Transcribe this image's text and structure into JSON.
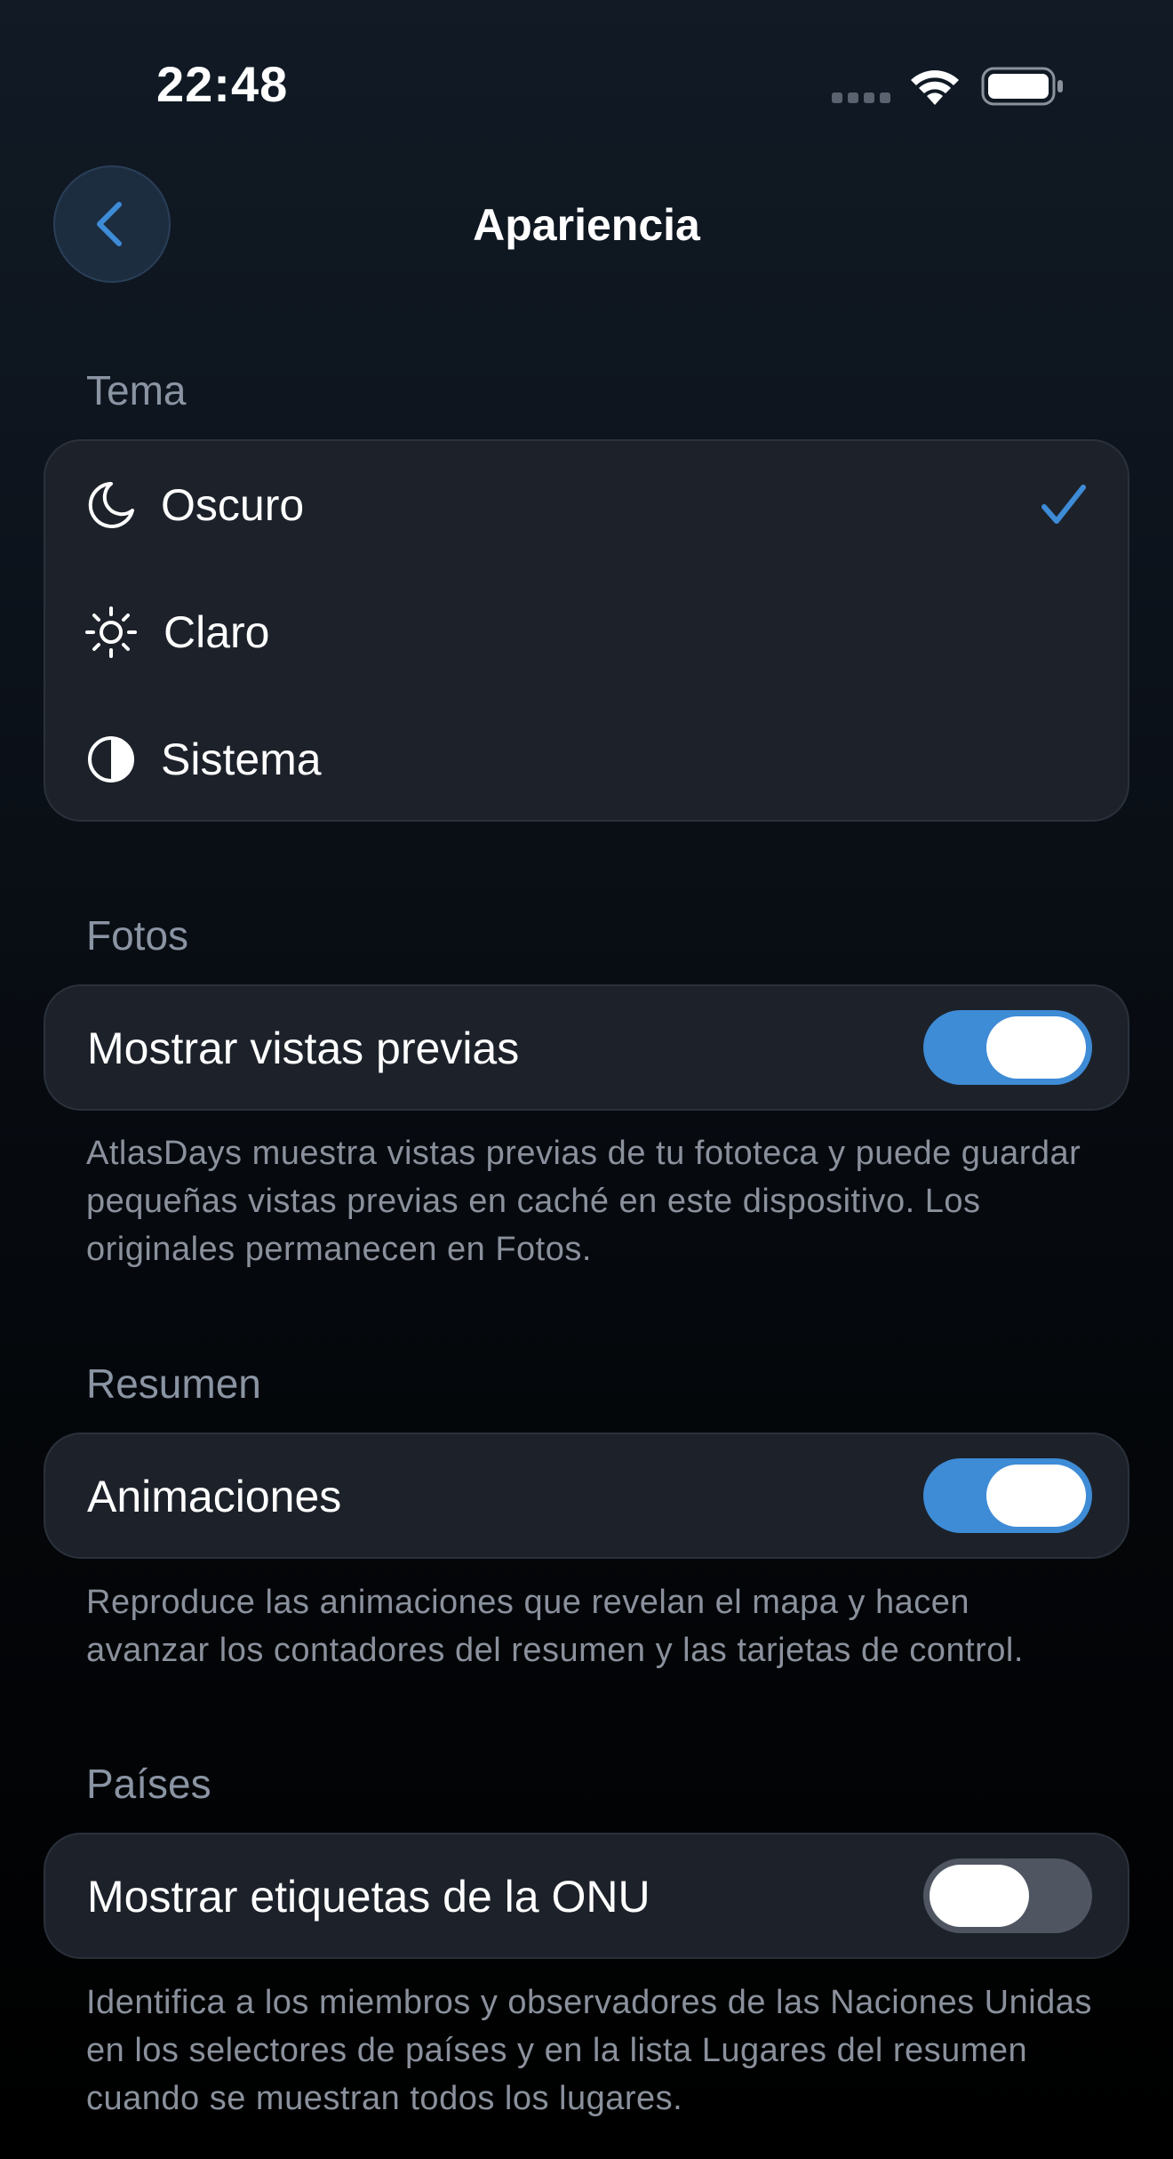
{
  "status_bar": {
    "time": "22:48"
  },
  "nav": {
    "title": "Apariencia",
    "back_icon": "chevron-left-icon"
  },
  "theme_section": {
    "header": "Tema",
    "options": [
      {
        "label": "Oscuro",
        "icon": "moon-icon",
        "selected": true
      },
      {
        "label": "Claro",
        "icon": "sun-icon",
        "selected": false
      },
      {
        "label": "Sistema",
        "icon": "half-circle-icon",
        "selected": false
      }
    ]
  },
  "photos_section": {
    "header": "Fotos",
    "toggle_label": "Mostrar vistas previas",
    "toggle_on": true,
    "footnote": "AtlasDays muestra vistas previas de tu fototeca y puede guardar pequeñas vistas previas en caché en este dispositivo. Los originales permanecen en Fotos."
  },
  "summary_section": {
    "header": "Resumen",
    "toggle_label": "Animaciones",
    "toggle_on": true,
    "footnote": "Reproduce las animaciones que revelan el mapa y hacen avanzar los contadores del resumen y las tarjetas de control."
  },
  "countries_section": {
    "header": "Países",
    "toggle_label": "Mostrar etiquetas de la ONU",
    "toggle_on": false,
    "footnote": "Identifica a los miembros y observadores de las Naciones Unidas en los selectores de países y en la lista Lugares del resumen cuando se muestran todos los lugares."
  },
  "colors": {
    "accent": "#3e8bd6",
    "card_bg": "#1d222a",
    "toggle_off": "#4f5561",
    "secondary_text": "#8a94a3"
  }
}
